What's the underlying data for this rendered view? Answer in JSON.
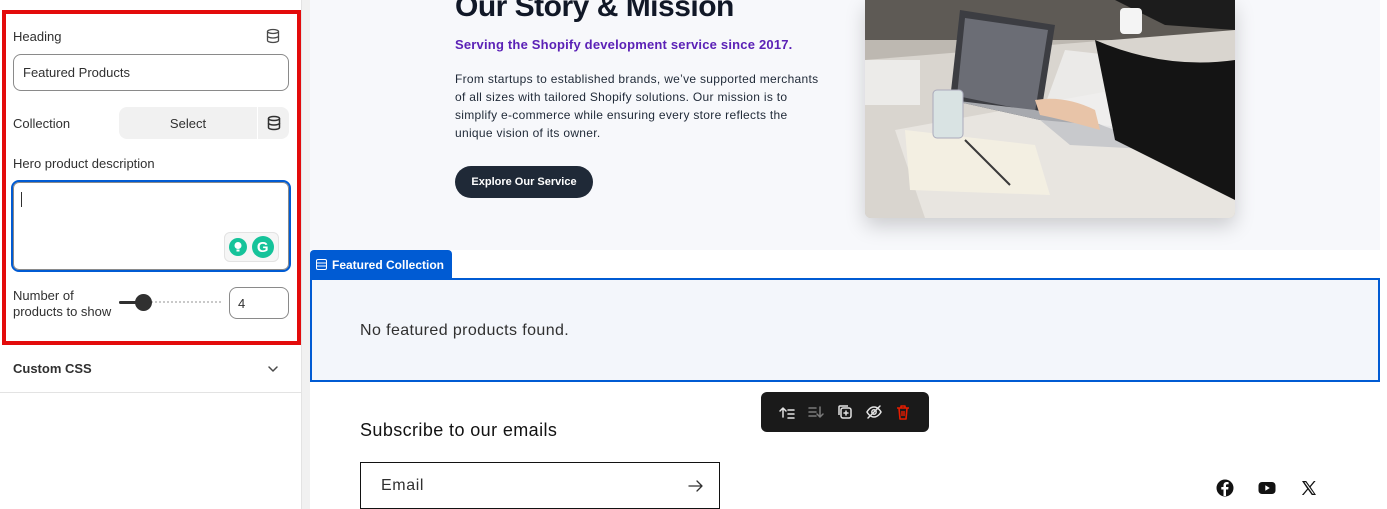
{
  "sidebar": {
    "heading_label": "Heading",
    "heading_value": "Featured Products",
    "collection_label": "Collection",
    "collection_select": "Select",
    "hero_desc_label": "Hero product description",
    "hero_desc_value": "",
    "num_products_label_1": "Number of",
    "num_products_label_2": "products to show",
    "num_products_value": "4",
    "custom_css_label": "Custom CSS"
  },
  "hero": {
    "title": "Our Story & Mission",
    "subtitle": "Serving the Shopify development service since 2017.",
    "paragraph": "From startups to established brands, we’ve supported merchants of all sizes with tailored Shopify solutions. Our mission is to simplify e-commerce while ensuring every store reflects the unique vision of its owner.",
    "button": "Explore Our Service"
  },
  "featured_collection": {
    "tag_label": "Featured Collection",
    "empty_message": "No featured products found."
  },
  "newsletter": {
    "title": "Subscribe to our emails",
    "email_placeholder": "Email"
  },
  "colors": {
    "highlight_border": "#e30b0b",
    "selection_blue": "#005bd3",
    "subtitle_purple": "#5b21b6",
    "delete_red": "#e51c00"
  },
  "icons": {
    "heading_source": "database-icon",
    "collection_source": "database-icon",
    "grammarly": "grammarly-icon",
    "custom_css_toggle": "chevron-down-icon",
    "toolbar": [
      "move-up-icon",
      "move-down-icon",
      "duplicate-icon",
      "hide-icon",
      "delete-icon"
    ],
    "social": [
      "facebook-icon",
      "youtube-icon",
      "x-icon"
    ]
  }
}
